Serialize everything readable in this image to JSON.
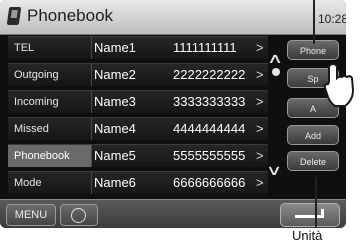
{
  "header": {
    "title": "Phonebook",
    "time": "10:28"
  },
  "list": {
    "categories": [
      "TEL",
      "Outgoing",
      "Incoming",
      "Missed",
      "Phonebook",
      "Mode"
    ],
    "selected_category": "Phonebook",
    "entries": [
      {
        "name": "Name1",
        "number": "1111111111",
        "arrow": ">"
      },
      {
        "name": "Name2",
        "number": "2222222222",
        "arrow": ">"
      },
      {
        "name": "Name3",
        "number": "3333333333",
        "arrow": ">"
      },
      {
        "name": "Name4",
        "number": "4444444444",
        "arrow": ">"
      },
      {
        "name": "Name5",
        "number": "5555555555",
        "arrow": ">"
      },
      {
        "name": "Name6",
        "number": "6666666666",
        "arrow": ">"
      }
    ]
  },
  "scroll": {
    "up": "∧",
    "down": "∨"
  },
  "side_buttons": [
    "Phone",
    "Sp",
    "A",
    "Add",
    "Delete"
  ],
  "bottom": {
    "menu_label": "MENU",
    "back_icon": "return-icon"
  },
  "annotation": {
    "label": "Unità"
  },
  "icons": {
    "phone": "phone-icon",
    "mic": "mic-icon",
    "hand": "hand-pointer-icon"
  },
  "colors": {
    "screen_bg": "#0f0f0f",
    "titlebar": "#d0d0d0",
    "selected_category": "#6a6a6a"
  }
}
